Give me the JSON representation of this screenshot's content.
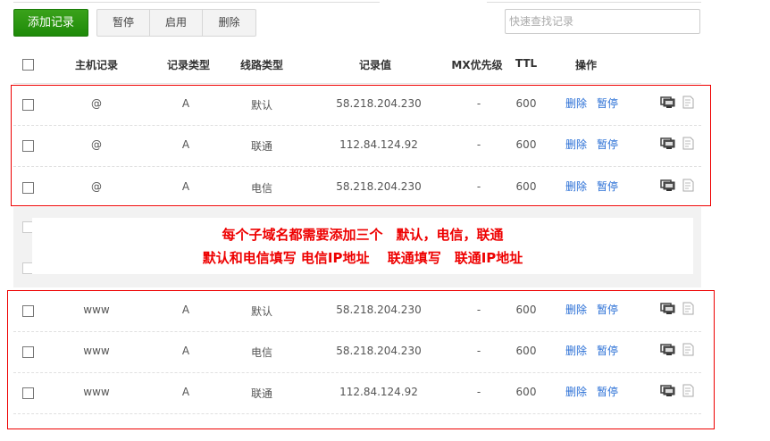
{
  "toolbar": {
    "add_label": "添加记录",
    "pause_label": "暂停",
    "enable_label": "启用",
    "delete_label": "删除",
    "search_placeholder": "快速查找记录"
  },
  "columns": {
    "host": "主机记录",
    "type": "记录类型",
    "line": "线路类型",
    "value": "记录值",
    "mx": "MX优先级",
    "ttl": "TTL",
    "ops": "操作"
  },
  "rows": [
    {
      "host": "@",
      "type": "A",
      "line": "默认",
      "value": "58.218.204.230",
      "mx": "-",
      "ttl": "600",
      "del": "删除",
      "pause": "暂停"
    },
    {
      "host": "@",
      "type": "A",
      "line": "联通",
      "value": "112.84.124.92",
      "mx": "-",
      "ttl": "600",
      "del": "删除",
      "pause": "暂停"
    },
    {
      "host": "@",
      "type": "A",
      "line": "电信",
      "value": "58.218.204.230",
      "mx": "-",
      "ttl": "600",
      "del": "删除",
      "pause": "暂停"
    },
    {
      "host": "www",
      "type": "A",
      "line": "默认",
      "value": "58.218.204.230",
      "mx": "-",
      "ttl": "600",
      "del": "删除",
      "pause": "暂停"
    },
    {
      "host": "www",
      "type": "A",
      "line": "电信",
      "value": "58.218.204.230",
      "mx": "-",
      "ttl": "600",
      "del": "删除",
      "pause": "暂停"
    },
    {
      "host": "www",
      "type": "A",
      "line": "联通",
      "value": "112.84.124.92",
      "mx": "-",
      "ttl": "600",
      "del": "删除",
      "pause": "暂停"
    }
  ],
  "annotation": {
    "line1": "每个子域名都需要添加三个　默认，电信，联通",
    "line2": "默认和电信填写 电信IP地址　 联通填写　联通IP地址"
  },
  "colors": {
    "accent": "#1e8a08",
    "link": "#2a6fd6",
    "annotation": "#ee0000"
  }
}
